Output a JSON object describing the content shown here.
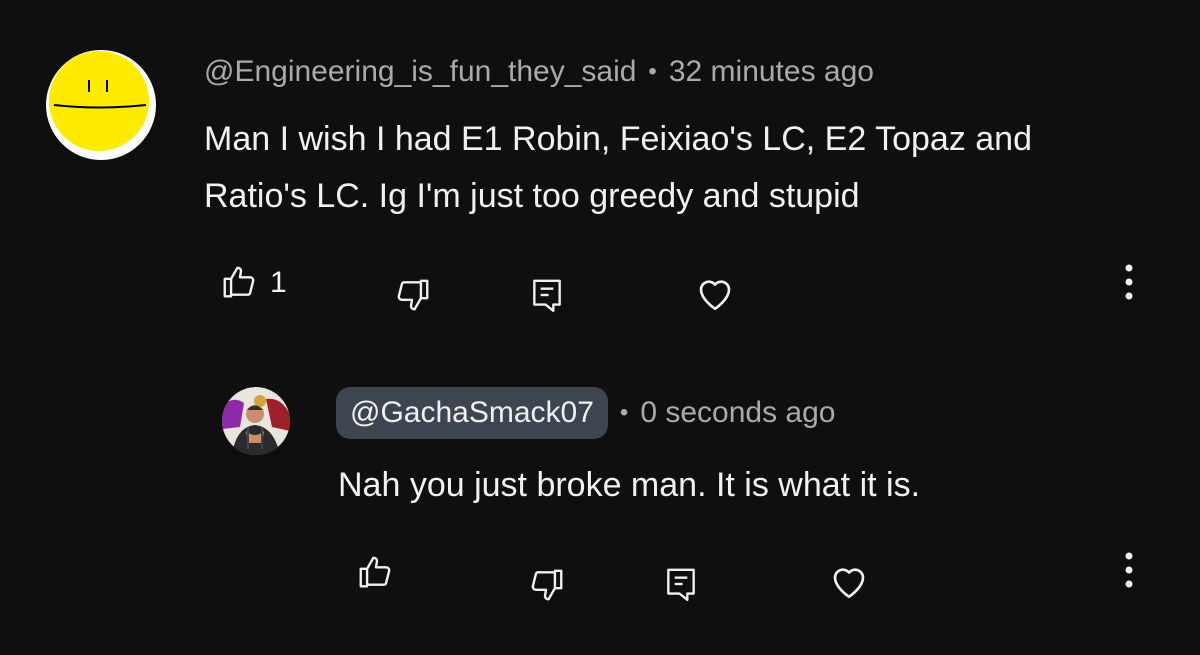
{
  "comment": {
    "author_handle": "@Engineering_is_fun_they_said",
    "separator": "•",
    "timestamp": "32 minutes ago",
    "text": "Man I wish I had E1 Robin, Feixiao's LC, E2 Topaz and Ratio's LC. Ig I'm just too greedy and stupid",
    "like_count": "1",
    "icons": [
      "thumbs-up-icon",
      "thumbs-down-icon",
      "reply-icon",
      "heart-icon",
      "more-vert-icon"
    ]
  },
  "reply": {
    "author_handle": "@GachaSmack07",
    "separator": "•",
    "timestamp": "0 seconds ago",
    "text": "Nah you just broke man. It is what it is.",
    "icons": [
      "thumbs-up-icon",
      "thumbs-down-icon",
      "reply-icon",
      "heart-icon",
      "more-vert-icon"
    ]
  },
  "colors": {
    "background": "#0f0f0f",
    "primary_text": "#f1f1f1",
    "secondary_text": "#aaaaaa",
    "handle_highlight": "#3d4550",
    "avatar_yellow": "#ffeb00"
  }
}
